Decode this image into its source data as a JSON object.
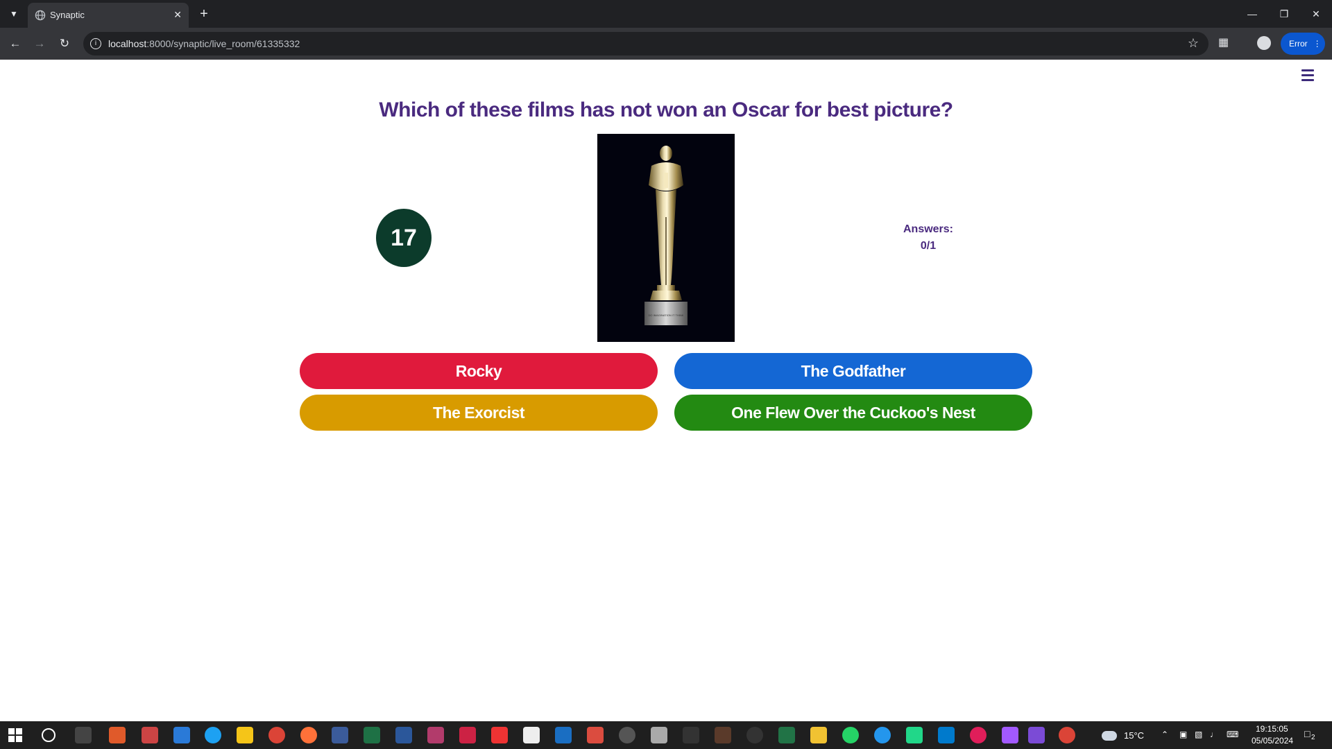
{
  "browser": {
    "tab_title": "Synaptic",
    "url_host": "localhost",
    "url_rest": ":8000/synaptic/live_room/61335332",
    "profile_status": "Error"
  },
  "quiz": {
    "question": "Which of these films has not won an Oscar for best picture?",
    "timer": "17",
    "answers_label": "Answers:",
    "answers_count": "0/1",
    "options": [
      {
        "label": "Rocky",
        "color": "#e01a3c"
      },
      {
        "label": "The Godfather",
        "color": "#1467d4"
      },
      {
        "label": "The Exorcist",
        "color": "#d89b00"
      },
      {
        "label": "One Flew Over the Cuckoo's Nest",
        "color": "#238a12"
      }
    ],
    "image_plaque_text": "DO IMAGINATION IT THINK"
  },
  "taskbar": {
    "weather": "15°C",
    "time": "19:15:05",
    "date": "05/05/2024",
    "notifications": "2"
  }
}
